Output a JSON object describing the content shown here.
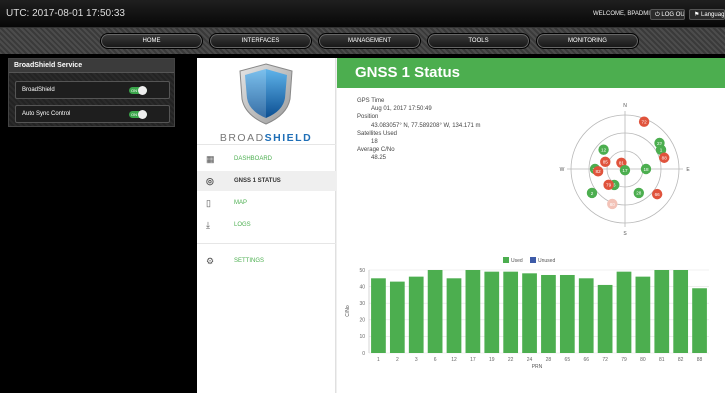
{
  "topbar": {
    "utc": "UTC: 2017-08-01 17:50:33",
    "welcome": "WELCOME, BPADMIN",
    "logout_label": "⏻ LOG OUT",
    "language_label": "⚑ Language"
  },
  "nav": {
    "items": [
      "HOME",
      "INTERFACES",
      "MANAGEMENT",
      "TOOLS",
      "MONITORING"
    ]
  },
  "service_panel": {
    "title": "BroadShield Service",
    "rows": [
      {
        "label": "BroadShield",
        "toggle": "ON",
        "state": true
      },
      {
        "label": "Auto Sync Control",
        "toggle": "ON",
        "state": true
      }
    ]
  },
  "brand": {
    "text_light": "BROAD",
    "text_bold": "SHIELD"
  },
  "menu": [
    {
      "label": "DASHBOARD",
      "icon": "dashboard-icon",
      "active": false
    },
    {
      "label": "GNSS 1 STATUS",
      "icon": "target-icon",
      "active": true
    },
    {
      "label": "MAP",
      "icon": "map-icon",
      "active": false
    },
    {
      "label": "LOGS",
      "icon": "download-icon",
      "active": false
    },
    {
      "label": "SETTINGS",
      "icon": "gear-icon",
      "active": false
    }
  ],
  "page": {
    "title": "GNSS 1 Status"
  },
  "gnss": {
    "gps_time_label": "GPS Time",
    "gps_time": "Aug 01, 2017 17:50:49",
    "position_label": "Position",
    "position": "43.083057° N, 77.589208° W, 134.171 m",
    "sats_used_label": "Satellites Used",
    "sats_used": "18",
    "avg_cno_label": "Average C/No",
    "avg_cno": "48.25"
  },
  "skyplot": {
    "compass": {
      "n": "N",
      "e": "E",
      "s": "S",
      "w": "W"
    },
    "satellites": [
      {
        "prn": "72",
        "used": false,
        "az": 22,
        "el": 5
      },
      {
        "prn": "12",
        "used": true,
        "az": 312,
        "el": 42
      },
      {
        "prn": "22",
        "used": true,
        "az": 53,
        "el": 18
      },
      {
        "prn": "1",
        "used": true,
        "az": 62,
        "el": 22
      },
      {
        "prn": "88",
        "used": false,
        "az": 74,
        "el": 22
      },
      {
        "prn": "24",
        "used": true,
        "az": 270,
        "el": 40
      },
      {
        "prn": "85",
        "used": false,
        "az": 290,
        "el": 55
      },
      {
        "prn": "81",
        "used": false,
        "az": 330,
        "el": 78
      },
      {
        "prn": "82",
        "used": false,
        "az": 265,
        "el": 45
      },
      {
        "prn": "17",
        "used": true,
        "az": 182,
        "el": 88
      },
      {
        "prn": "18",
        "used": true,
        "az": 90,
        "el": 55
      },
      {
        "prn": "6",
        "used": true,
        "az": 214,
        "el": 58
      },
      {
        "prn": "79",
        "used": false,
        "az": 226,
        "el": 52
      },
      {
        "prn": "66",
        "used": false,
        "az": 128,
        "el": 22
      },
      {
        "prn": "28",
        "used": true,
        "az": 150,
        "el": 44
      },
      {
        "prn": "2",
        "used": true,
        "az": 234,
        "el": 22
      },
      {
        "prn": "80",
        "used": false,
        "az": 200,
        "el": 28,
        "faded": true
      }
    ]
  },
  "chart_data": {
    "type": "bar",
    "categories": [
      "1",
      "2",
      "3",
      "6",
      "12",
      "17",
      "19",
      "22",
      "24",
      "28",
      "65",
      "66",
      "72",
      "79",
      "80",
      "81",
      "82",
      "88"
    ],
    "series": [
      {
        "name": "Used",
        "values": [
          45,
          43,
          46,
          50,
          45,
          50,
          49,
          49,
          48,
          47,
          47,
          45,
          41,
          49,
          46,
          50,
          50,
          39
        ]
      }
    ],
    "legend": [
      "Used",
      "Unused"
    ],
    "xlabel": "PRN",
    "ylabel": "C/No",
    "ylim": [
      0,
      50
    ],
    "yticks": [
      0,
      10,
      20,
      30,
      40,
      50
    ],
    "colors": {
      "used": "#4cae4f",
      "unused": "#3e5ba8"
    }
  }
}
